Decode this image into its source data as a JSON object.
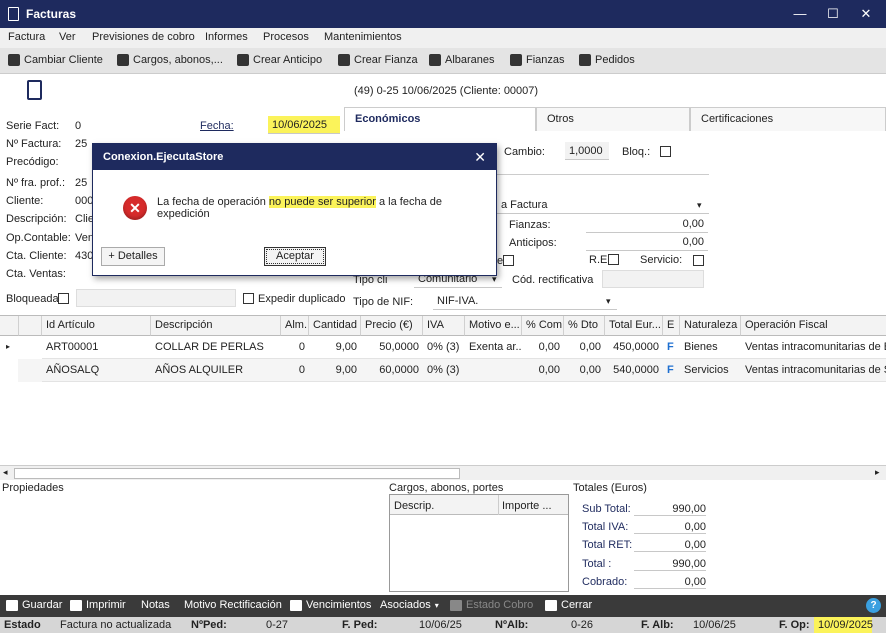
{
  "window": {
    "title": "Facturas",
    "minimize": "—",
    "maximize": "☐",
    "close": "✕"
  },
  "menu": [
    "Factura",
    "Ver",
    "Previsiones de cobro",
    "Informes",
    "Procesos",
    "Mantenimientos"
  ],
  "toolbar": {
    "cambiar_cliente": "Cambiar Cliente",
    "cargos": "Cargos, abonos,...",
    "crear_anticipo": "Crear Anticipo",
    "crear_fianza": "Crear Fianza",
    "albaranes": "Albaranes",
    "fianzas": "Fianzas",
    "pedidos": "Pedidos"
  },
  "doc_header": "(49) 0-25  10/06/2025  (Cliente: 00007)",
  "form": {
    "serie_label": "Serie Fact:",
    "serie_value": "0",
    "fecha_label": "Fecha:",
    "fecha_value": "10/06/2025",
    "nfactura_label": "Nº Factura:",
    "nfactura_value": "25",
    "precodigo_label": "Precódigo:",
    "nfraprof_label": "Nº fra. prof.:",
    "nfraprof_value": "25",
    "cliente_label": "Cliente:",
    "cliente_value": "000",
    "descripcion_label": "Descripción:",
    "descripcion_value": "Clie",
    "opcontable_label": "Op.Contable:",
    "opcontable_value": "Vent",
    "ctacliente_label": "Cta. Cliente:",
    "ctacliente_value": "430",
    "ctaventas_label": "Cta. Ventas:",
    "bloqueada_label": "Bloqueada",
    "expedir_label": "Expedir duplicado"
  },
  "tabs": [
    "Económicos",
    "Otros",
    "Certificaciones"
  ],
  "economicos": {
    "cambio_label": "Cambio:",
    "cambio_value": "1,0000",
    "bloq_label": "Bloq.:",
    "tipo_factura": "a Factura",
    "fianzas_label": "Fianzas:",
    "fianzas_value": "0,00",
    "anticipos_label": "Anticipos:",
    "anticipos_value": "0,00",
    "re_label": "R.E.",
    "servicio_label": "Servicio:",
    "e_label": "e",
    "tipo_cli_label": "Tipo cli",
    "tipo_cli_value": "Comunitario",
    "cod_rect_label": "Cód. rectificativa",
    "tipo_nif_label": "Tipo de NIF:",
    "tipo_nif_value": "NIF-IVA."
  },
  "grid": {
    "headers": [
      "Id Artículo",
      "Descripción",
      "Alm.",
      "Cantidad",
      "Precio (€)",
      "IVA",
      "Motivo e...",
      "% Com",
      "% Dto",
      "Total Eur...",
      "E",
      "Naturaleza",
      "Operación Fiscal"
    ],
    "rows": [
      [
        "ART00001",
        "COLLAR DE PERLAS",
        "0",
        "9,00",
        "50,0000",
        "0% (3)",
        "Exenta ar...",
        "0,00",
        "0,00",
        "450,0000",
        "F",
        "Bienes",
        "Ventas intracomunitarias de Bie"
      ],
      [
        "AÑOSALQ",
        "AÑOS ALQUILER",
        "0",
        "9,00",
        "60,0000",
        "0% (3)",
        "",
        "0,00",
        "0,00",
        "540,0000",
        "F",
        "Servicios",
        "Ventas intracomunitarias de Ser"
      ]
    ]
  },
  "bottom": {
    "propiedades": "Propiedades",
    "cargos_title": "Cargos, abonos, portes",
    "cargos_col1": "Descrip.",
    "cargos_col2": "Importe ...",
    "totales_title": "Totales (Euros)",
    "subtotal_label": "Sub Total:",
    "subtotal_value": "990,00",
    "iva_label": "Total IVA:",
    "iva_value": "0,00",
    "ret_label": "Total RET:",
    "ret_value": "0,00",
    "total_label": "Total :",
    "total_value": "990,00",
    "cobrado_label": "Cobrado:",
    "cobrado_value": "0,00"
  },
  "actions": {
    "guardar": "Guardar",
    "imprimir": "Imprimir",
    "notas": "Notas",
    "motivo": "Motivo Rectificación",
    "vencimientos": "Vencimientos",
    "asociados": "Asociados",
    "estado_cobro": "Estado Cobro",
    "cerrar": "Cerrar"
  },
  "status": {
    "estado_label": "Estado",
    "estado_value": "Factura no actualizada",
    "nped_label": "NºPed:",
    "nped_value": "0-27",
    "fped_label": "F. Ped:",
    "fped_value": "10/06/25",
    "nalb_label": "NºAlb:",
    "nalb_value": "0-26",
    "falb_label": "F. Alb:",
    "falb_value": "10/06/25",
    "fop_label": "F. Op:",
    "fop_value": "10/09/2025"
  },
  "dialog": {
    "title": "Conexion.EjecutaStore",
    "close": "✕",
    "msg_pre": "La fecha de operación ",
    "msg_hl": "no puede ser superior",
    "msg_post": " a la fecha de expedición",
    "details_button": "+ Detalles",
    "accept_button": "Aceptar"
  },
  "colors": {
    "titlebar": "#1e2a5e",
    "highlight": "#fbf35a",
    "error": "#d62b2b"
  }
}
